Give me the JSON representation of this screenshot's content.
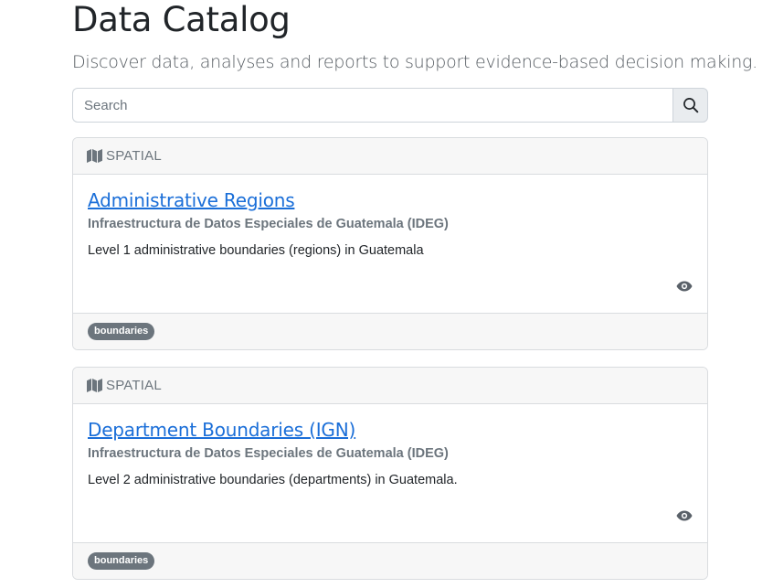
{
  "header": {
    "title": "Data Catalog",
    "lead": "Discover data, analyses and reports to support evidence-based decision making."
  },
  "search": {
    "placeholder": "Search",
    "button_icon": "search-icon"
  },
  "results": [
    {
      "type_icon": "map-icon",
      "type_label": "SPATIAL",
      "title": "Administrative Regions",
      "organization": "Infraestructura de Datos Especiales de Guatemala (IDEG)",
      "description": "Level 1 administrative boundaries (regions) in Guatemala",
      "view_icon": "eye-icon",
      "tags": [
        "boundaries"
      ]
    },
    {
      "type_icon": "map-icon",
      "type_label": "SPATIAL",
      "title": "Department Boundaries (IGN)",
      "organization": "Infraestructura de Datos Especiales de Guatemala (IDEG)",
      "description": "Level 2 administrative boundaries (departments) in Guatemala.",
      "view_icon": "eye-icon",
      "tags": [
        "boundaries"
      ]
    }
  ],
  "colors": {
    "link": "#1a6ed8",
    "muted": "#6c757d",
    "badge": "#6c757d",
    "card_header_bg": "#f7f7f7"
  }
}
